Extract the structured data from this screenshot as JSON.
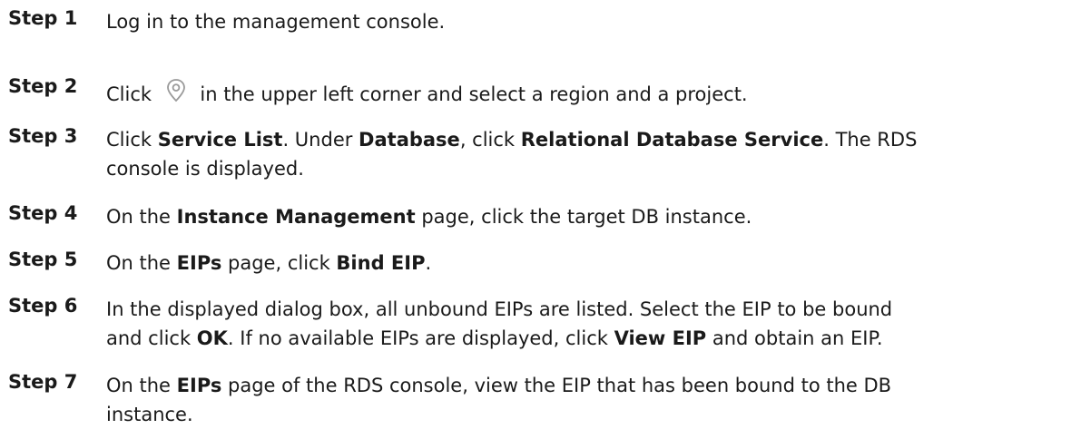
{
  "steps": [
    {
      "label": "Step 1",
      "text": "Log in to the management console."
    },
    {
      "label": "Step 2",
      "pre": "Click",
      "icon": "location-pin-icon",
      "post": "in the upper left corner and select a region and a project."
    },
    {
      "label": "Step 3",
      "t1": "Click ",
      "b1": "Service List",
      "t2": ". Under ",
      "b2": "Database",
      "t3": ", click ",
      "b3": "Relational Database Service",
      "t4": ". The RDS",
      "t5": "console is displayed."
    },
    {
      "label": "Step 4",
      "t1": "On the ",
      "b1": "Instance Management",
      "t2": " page, click the target DB instance."
    },
    {
      "label": "Step 5",
      "t1": "On the ",
      "b1": "EIPs",
      "t2": " page, click ",
      "b2": "Bind EIP",
      "t3": "."
    },
    {
      "label": "Step 6",
      "t1": "In the displayed dialog box, all unbound EIPs are listed. Select the EIP to be bound",
      "t2": "and click ",
      "b1": "OK",
      "t3": ". If no available EIPs are displayed, click ",
      "b2": "View EIP",
      "t4": " and obtain an EIP."
    },
    {
      "label": "Step 7",
      "t1": "On the ",
      "b1": "EIPs",
      "t2": " page of the RDS console, view the EIP that has been bound to the DB",
      "t3": "instance."
    }
  ],
  "colors": {
    "text": "#1a1a1a",
    "icon": "#9a9a9a"
  }
}
